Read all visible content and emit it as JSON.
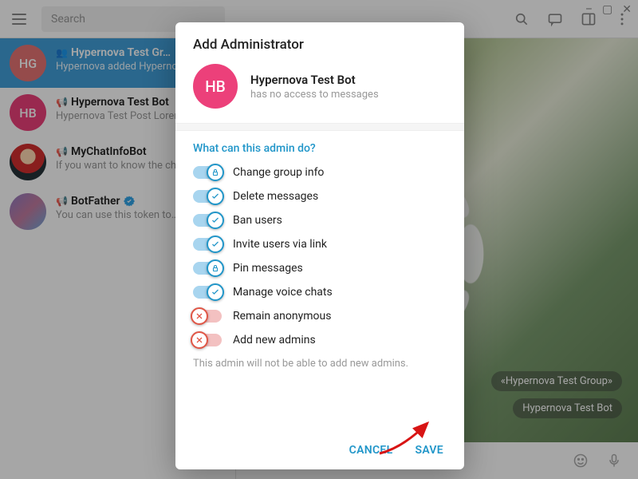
{
  "window": {
    "minimize": "–",
    "maximize": "▢",
    "close": "✕"
  },
  "topbar": {
    "search_placeholder": "Search"
  },
  "sidebar": {
    "items": [
      {
        "title": "Hypernova Test Gr…",
        "sub": "Hypernova added Hypernova…",
        "initials": "HG",
        "icon": "group"
      },
      {
        "title": "Hypernova Test Bot",
        "sub": "Hypernova Test Post  Lorem…",
        "initials": "HB",
        "icon": "channel"
      },
      {
        "title": "MyChatInfoBot",
        "sub": "If you want to know the chat…",
        "icon": "channel"
      },
      {
        "title": "BotFather",
        "sub": "You can use this token to…",
        "icon": "channel",
        "verified": true
      }
    ]
  },
  "content": {
    "pill1": "«Hypernova Test Group»",
    "pill2": "Hypernova Test Bot"
  },
  "dialog": {
    "title": "Add Administrator",
    "avatar_initials": "HB",
    "name": "Hypernova Test Bot",
    "status": "has no access to messages",
    "section_heading": "What can this admin do?",
    "permissions": [
      {
        "label": "Change group info",
        "on": true,
        "icon": "lock"
      },
      {
        "label": "Delete messages",
        "on": true,
        "icon": "check"
      },
      {
        "label": "Ban users",
        "on": true,
        "icon": "check"
      },
      {
        "label": "Invite users via link",
        "on": true,
        "icon": "check"
      },
      {
        "label": "Pin messages",
        "on": true,
        "icon": "lock"
      },
      {
        "label": "Manage voice chats",
        "on": true,
        "icon": "check"
      },
      {
        "label": "Remain anonymous",
        "on": false,
        "icon": "cross"
      },
      {
        "label": "Add new admins",
        "on": false,
        "icon": "cross"
      }
    ],
    "hint": "This admin will not be able to add new admins.",
    "cancel": "CANCEL",
    "save": "SAVE"
  }
}
